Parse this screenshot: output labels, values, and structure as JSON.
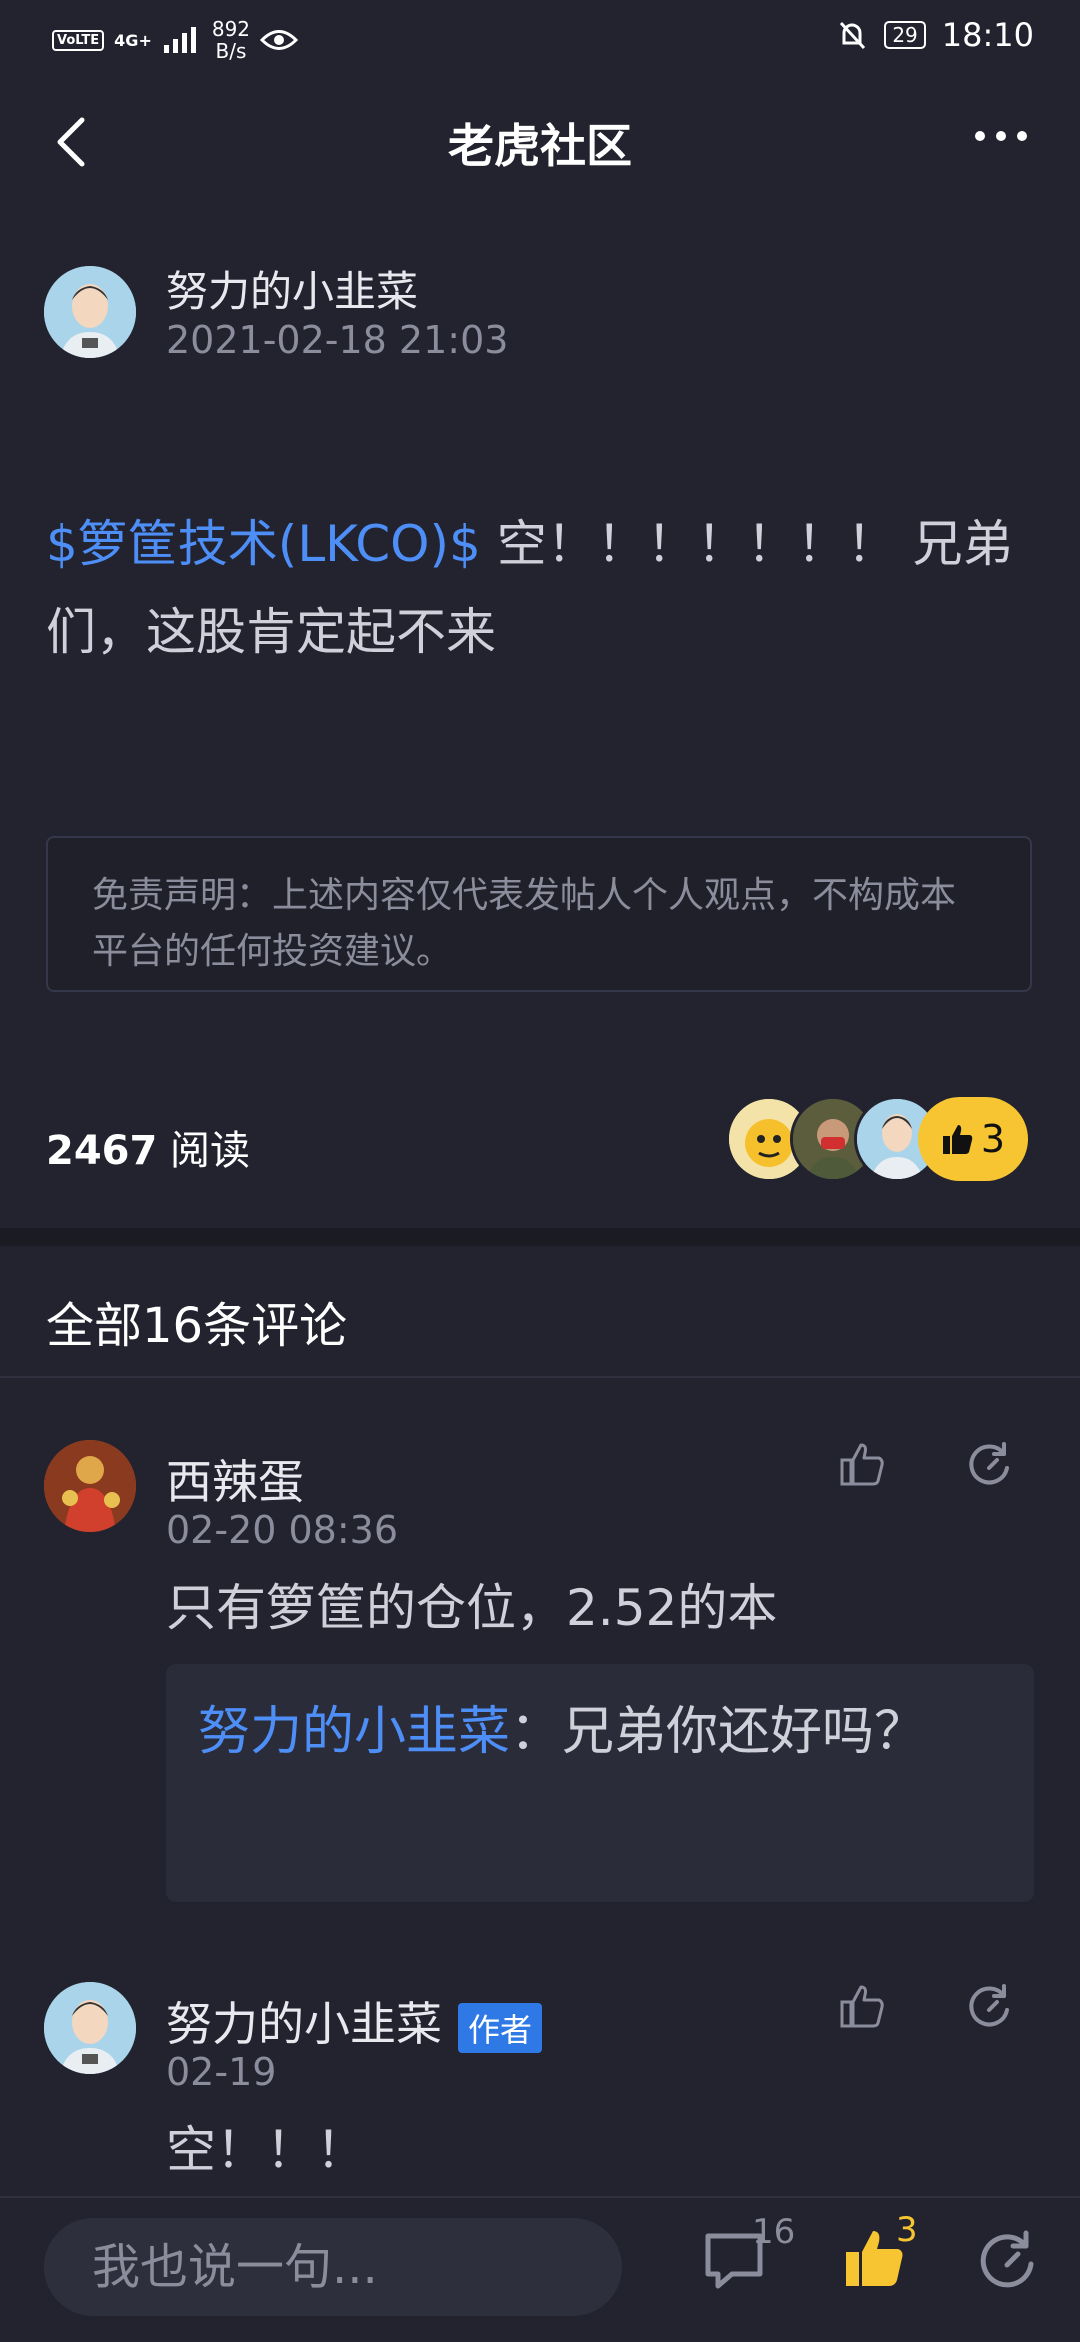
{
  "status_bar": {
    "volte": "VoLTE",
    "network": "4G+",
    "speed_top": "892",
    "speed_unit": "B/s",
    "battery": "29",
    "time": "18:10"
  },
  "header": {
    "title": "老虎社区"
  },
  "post": {
    "author": "努力的小韭菜",
    "time": "2021-02-18 21:03",
    "stock_tag": "$箩筐技术(LKCO)$",
    "text": " 空！！！！！！！ 兄弟们，这股肯定起不来",
    "disclaimer": "免责声明：上述内容仅代表发帖人个人观点，不构成本平台的任何投资建议。",
    "read_count": "2467",
    "read_label": " 阅读",
    "like_count": "3"
  },
  "comments_section": {
    "title": "全部16条评论"
  },
  "comments": [
    {
      "name": "西辣蛋",
      "time": "02-20 08:36",
      "text": "只有箩筐的仓位，2.52的本",
      "reply_name": "努力的小韭菜",
      "reply_text": "：兄弟你还好吗？"
    },
    {
      "name": "努力的小韭菜",
      "tag": "作者",
      "time": "02-19",
      "text": "空！！！"
    }
  ],
  "bottom_bar": {
    "input_placeholder": "我也说一句...",
    "comment_count": "16",
    "like_count": "3"
  },
  "colors": {
    "background": "#22232f",
    "accent_blue": "#4e8ef7",
    "like_yellow": "#f6c531"
  }
}
